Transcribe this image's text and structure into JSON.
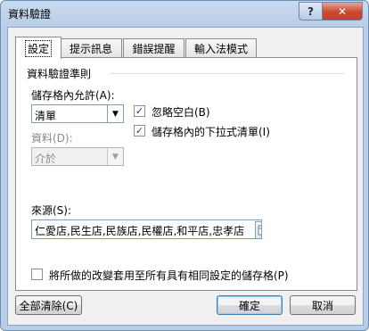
{
  "window": {
    "title": "資料驗證",
    "help_label": "?",
    "close_label": "✕"
  },
  "tabs": [
    {
      "label": "設定",
      "active": true
    },
    {
      "label": "提示訊息"
    },
    {
      "label": "錯誤提醒"
    },
    {
      "label": "輸入法模式"
    }
  ],
  "criteria": {
    "group_title": "資料驗證準則",
    "allow_label": "儲存格內允許(A):",
    "allow_value": "清單",
    "ignore_blank_label": "忽略空白(B)",
    "ignore_blank_checked": true,
    "dropdown_label": "儲存格內的下拉式清單(I)",
    "dropdown_checked": true,
    "data_label": "資料(D):",
    "data_value": "介於",
    "source_label": "來源(S):",
    "source_value": "仁愛店,民生店,民族店,民權店,和平店,忠孝店"
  },
  "apply_all": {
    "label": "將所做的改變套用至所有具有相同設定的儲存格(P)",
    "checked": false
  },
  "buttons": {
    "clear_all": "全部清除(C)",
    "ok": "確定",
    "cancel": "取消"
  },
  "icons": {
    "dropdown_arrow": "▼",
    "check": "✓",
    "range_picker": "range-picker-icon"
  }
}
